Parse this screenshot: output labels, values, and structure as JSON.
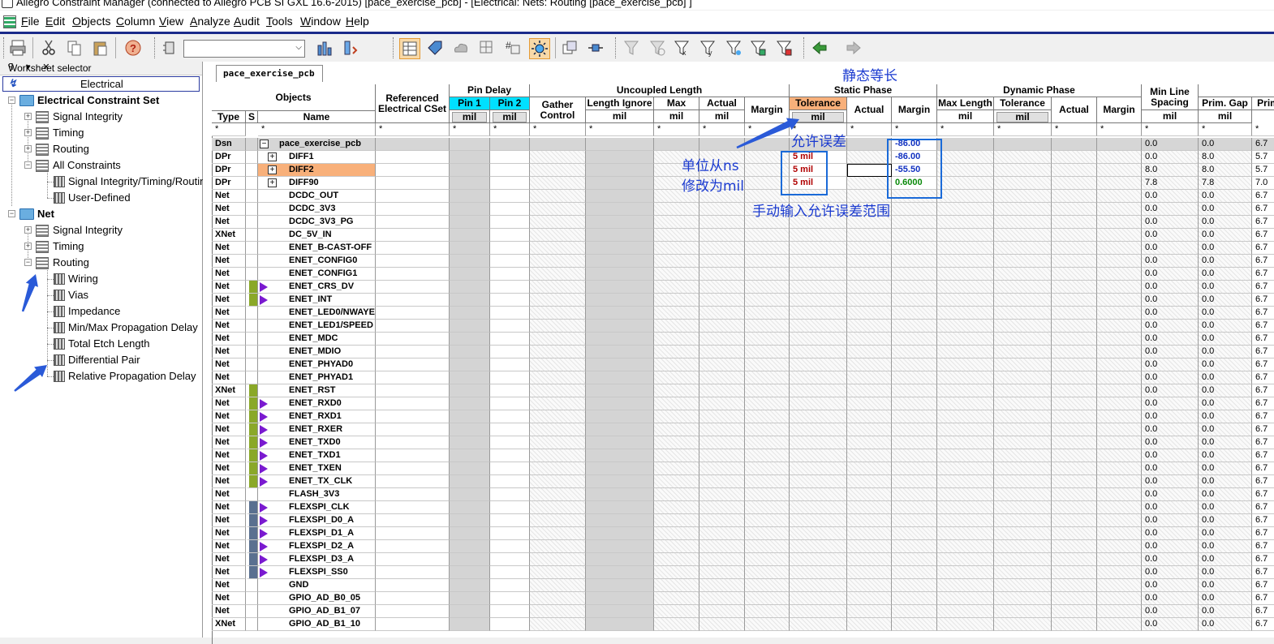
{
  "window": {
    "title": "Allegro Constraint Manager (connected to Allegro PCB SI GXL 16.6-2015) [pace_exercise_pcb] - [Electrical:  Nets:  Routing [pace_exercise_pcb] ]"
  },
  "menu": [
    {
      "u": "F",
      "rest": "ile"
    },
    {
      "u": "E",
      "rest": "dit"
    },
    {
      "u": "O",
      "rest": "bjects"
    },
    {
      "u": "C",
      "rest": "olumn"
    },
    {
      "u": "V",
      "rest": "iew"
    },
    {
      "u": "A",
      "rest": "nalyze"
    },
    {
      "u": "A",
      "rest": "udit"
    },
    {
      "u": "T",
      "rest": "ools"
    },
    {
      "u": "W",
      "rest": "indow"
    },
    {
      "u": "H",
      "rest": "elp"
    }
  ],
  "worksheet_selector": {
    "title": "Worksheet selector",
    "header_buttons": "ꟼ ▾ ✕",
    "tab": "Electrical",
    "tree": [
      {
        "label": "Electrical Constraint Set",
        "bold": true
      },
      {
        "label": "Signal Integrity"
      },
      {
        "label": "Timing"
      },
      {
        "label": "Routing"
      },
      {
        "label": "All Constraints"
      },
      {
        "label": "Signal Integrity/Timing/Routing"
      },
      {
        "label": "User-Defined"
      },
      {
        "label": "Net",
        "bold": true
      },
      {
        "label": "Signal Integrity"
      },
      {
        "label": "Timing"
      },
      {
        "label": "Routing"
      },
      {
        "label": "Wiring"
      },
      {
        "label": "Vias"
      },
      {
        "label": "Impedance"
      },
      {
        "label": "Min/Max Propagation Delay"
      },
      {
        "label": "Total Etch Length"
      },
      {
        "label": "Differential Pair"
      },
      {
        "label": "Relative Propagation Delay"
      }
    ]
  },
  "sheet_tab": "pace_exercise_pcb",
  "headers": {
    "objects": "Objects",
    "ref_cset": "Referenced Electrical CSet",
    "pin_delay": "Pin Delay",
    "pin1": "Pin 1",
    "pin2": "Pin 2",
    "uncoupled_length": "Uncoupled Length",
    "gather_control": "Gather Control",
    "length_ignore": "Length Ignore",
    "max": "Max",
    "actual": "Actual",
    "margin": "Margin",
    "static_phase": "Static Phase",
    "tolerance": "Tolerance",
    "sp_actual": "Actual",
    "sp_margin": "Margin",
    "dynamic_phase": "Dynamic Phase",
    "max_length": "Max Length",
    "dp_tolerance": "Tolerance",
    "dp_actual": "Actual",
    "dp_margin": "Margin",
    "min_line_spacing": "Min Line Spacing",
    "prim_gap": "Prim. Gap",
    "prim": "Prim",
    "type": "Type",
    "s": "S",
    "name": "Name",
    "unit": "mil",
    "filter": "*"
  },
  "rows": [
    {
      "type": "Dsn",
      "name": "pace_exercise_pcb",
      "mark": "minus",
      "tol": "",
      "spm": "-86.00",
      "mls": "0.0",
      "pg": "0.0",
      "pr": "6.7",
      "dsn": true
    },
    {
      "type": "DPr",
      "name": "DIFF1",
      "mark": "plus",
      "tol": "5 mil",
      "spm": "-86.00",
      "mls": "0.0",
      "pg": "8.0",
      "pr": "5.7"
    },
    {
      "type": "DPr",
      "name": "DIFF2",
      "mark": "plus",
      "tol": "5 mil",
      "spm": "-55.50",
      "mls": "8.0",
      "pg": "8.0",
      "pr": "5.7",
      "highlight": true
    },
    {
      "type": "DPr",
      "name": "DIFF90",
      "mark": "plus",
      "tol": "5 mil",
      "spm": "0.6000",
      "mls": "7.8",
      "pg": "7.8",
      "pr": "7.0",
      "green": true
    },
    {
      "type": "Net",
      "name": "DCDC_OUT",
      "mls": "0.0",
      "pg": "0.0",
      "pr": "6.7"
    },
    {
      "type": "Net",
      "name": "DCDC_3V3",
      "mls": "0.0",
      "pg": "0.0",
      "pr": "6.7"
    },
    {
      "type": "Net",
      "name": "DCDC_3V3_PG",
      "mls": "0.0",
      "pg": "0.0",
      "pr": "6.7"
    },
    {
      "type": "XNet",
      "name": "DC_5V_IN",
      "mls": "0.0",
      "pg": "0.0",
      "pr": "6.7"
    },
    {
      "type": "Net",
      "name": "ENET_B-CAST-OFF",
      "mls": "0.0",
      "pg": "0.0",
      "pr": "6.7"
    },
    {
      "type": "Net",
      "name": "ENET_CONFIG0",
      "mls": "0.0",
      "pg": "0.0",
      "pr": "6.7"
    },
    {
      "type": "Net",
      "name": "ENET_CONFIG1",
      "mls": "0.0",
      "pg": "0.0",
      "pr": "6.7"
    },
    {
      "type": "Net",
      "name": "ENET_CRS_DV",
      "mark": "tri",
      "bar": "green",
      "mls": "0.0",
      "pg": "0.0",
      "pr": "6.7"
    },
    {
      "type": "Net",
      "name": "ENET_INT",
      "mark": "tri",
      "bar": "green",
      "mls": "0.0",
      "pg": "0.0",
      "pr": "6.7"
    },
    {
      "type": "Net",
      "name": "ENET_LED0/NWAYEN",
      "mls": "0.0",
      "pg": "0.0",
      "pr": "6.7"
    },
    {
      "type": "Net",
      "name": "ENET_LED1/SPEED",
      "mls": "0.0",
      "pg": "0.0",
      "pr": "6.7"
    },
    {
      "type": "Net",
      "name": "ENET_MDC",
      "mls": "0.0",
      "pg": "0.0",
      "pr": "6.7"
    },
    {
      "type": "Net",
      "name": "ENET_MDIO",
      "mls": "0.0",
      "pg": "0.0",
      "pr": "6.7"
    },
    {
      "type": "Net",
      "name": "ENET_PHYAD0",
      "mls": "0.0",
      "pg": "0.0",
      "pr": "6.7"
    },
    {
      "type": "Net",
      "name": "ENET_PHYAD1",
      "mls": "0.0",
      "pg": "0.0",
      "pr": "6.7"
    },
    {
      "type": "XNet",
      "name": "ENET_RST",
      "bar": "green",
      "mls": "0.0",
      "pg": "0.0",
      "pr": "6.7"
    },
    {
      "type": "Net",
      "name": "ENET_RXD0",
      "mark": "tri",
      "bar": "green",
      "mls": "0.0",
      "pg": "0.0",
      "pr": "6.7"
    },
    {
      "type": "Net",
      "name": "ENET_RXD1",
      "mark": "tri",
      "bar": "green",
      "mls": "0.0",
      "pg": "0.0",
      "pr": "6.7"
    },
    {
      "type": "Net",
      "name": "ENET_RXER",
      "mark": "tri",
      "bar": "green",
      "mls": "0.0",
      "pg": "0.0",
      "pr": "6.7"
    },
    {
      "type": "Net",
      "name": "ENET_TXD0",
      "mark": "tri",
      "bar": "green",
      "mls": "0.0",
      "pg": "0.0",
      "pr": "6.7"
    },
    {
      "type": "Net",
      "name": "ENET_TXD1",
      "mark": "tri",
      "bar": "green",
      "mls": "0.0",
      "pg": "0.0",
      "pr": "6.7"
    },
    {
      "type": "Net",
      "name": "ENET_TXEN",
      "mark": "tri",
      "bar": "green",
      "mls": "0.0",
      "pg": "0.0",
      "pr": "6.7"
    },
    {
      "type": "Net",
      "name": "ENET_TX_CLK",
      "mark": "tri",
      "bar": "green",
      "mls": "0.0",
      "pg": "0.0",
      "pr": "6.7"
    },
    {
      "type": "Net",
      "name": "FLASH_3V3",
      "mls": "0.0",
      "pg": "0.0",
      "pr": "6.7"
    },
    {
      "type": "Net",
      "name": "FLEXSPI_CLK",
      "mark": "tri",
      "bar": "slate",
      "mls": "0.0",
      "pg": "0.0",
      "pr": "6.7"
    },
    {
      "type": "Net",
      "name": "FLEXSPI_D0_A",
      "mark": "tri",
      "bar": "slate",
      "mls": "0.0",
      "pg": "0.0",
      "pr": "6.7"
    },
    {
      "type": "Net",
      "name": "FLEXSPI_D1_A",
      "mark": "tri",
      "bar": "slate",
      "mls": "0.0",
      "pg": "0.0",
      "pr": "6.7"
    },
    {
      "type": "Net",
      "name": "FLEXSPI_D2_A",
      "mark": "tri",
      "bar": "slate",
      "mls": "0.0",
      "pg": "0.0",
      "pr": "6.7"
    },
    {
      "type": "Net",
      "name": "FLEXSPI_D3_A",
      "mark": "tri",
      "bar": "slate",
      "mls": "0.0",
      "pg": "0.0",
      "pr": "6.7"
    },
    {
      "type": "Net",
      "name": "FLEXSPI_SS0",
      "mark": "tri",
      "bar": "slate",
      "mls": "0.0",
      "pg": "0.0",
      "pr": "6.7"
    },
    {
      "type": "Net",
      "name": "GND",
      "mls": "0.0",
      "pg": "0.0",
      "pr": "6.7"
    },
    {
      "type": "Net",
      "name": "GPIO_AD_B0_05",
      "mls": "0.0",
      "pg": "0.0",
      "pr": "6.7"
    },
    {
      "type": "Net",
      "name": "GPIO_AD_B1_07",
      "mls": "0.0",
      "pg": "0.0",
      "pr": "6.7"
    },
    {
      "type": "XNet",
      "name": "GPIO_AD_B1_10",
      "mls": "0.0",
      "pg": "0.0",
      "pr": "6.7"
    }
  ],
  "annotations": {
    "static_equal": "静态等长",
    "tolerance_note": "允许误差",
    "unit_note_1": "单位从ns",
    "unit_note_2": "修改为mil",
    "manual_note": "手动输入允许误差范围"
  },
  "colors": {
    "pin_header": "#00e0ff",
    "tolerance_header": "#f8b07a",
    "annotation": "#1a3ad0",
    "margin_negative": "#1030c0",
    "margin_positive": "#0a8a0a",
    "tolerance_value": "#b00000"
  }
}
